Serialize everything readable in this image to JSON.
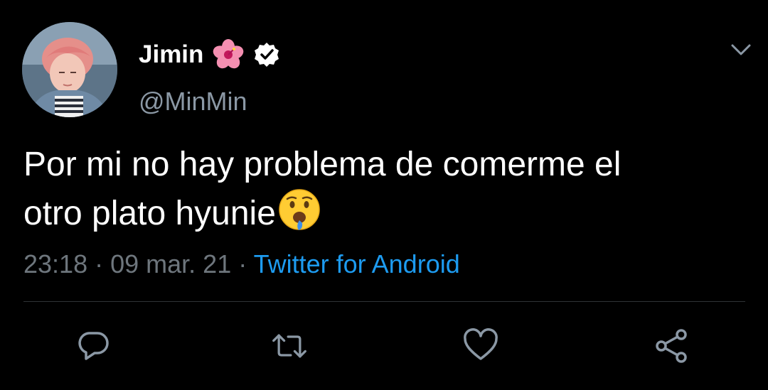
{
  "tweet": {
    "author": {
      "display_name": "Jimin",
      "handle": "@MinMin",
      "verified": true,
      "name_emoji_icon": "hibiscus-icon",
      "avatar": "profile-photo"
    },
    "text_line1": "Por mi no hay problema de comerme el",
    "text_line2": "otro plato hyunie",
    "text_emoji_icon": "drooling-face-icon",
    "time": "23:18",
    "date": "09 mar. 21",
    "separator": "·",
    "source": "Twitter for Android"
  },
  "actions": {
    "icons": [
      "reply-icon",
      "retweet-icon",
      "like-icon",
      "share-icon"
    ]
  },
  "colors": {
    "background": "#000000",
    "text": "#ffffff",
    "secondary_text": "#6e767d",
    "link": "#1d9bf0",
    "divider": "#2f3336",
    "icon": "#8b98a5"
  }
}
